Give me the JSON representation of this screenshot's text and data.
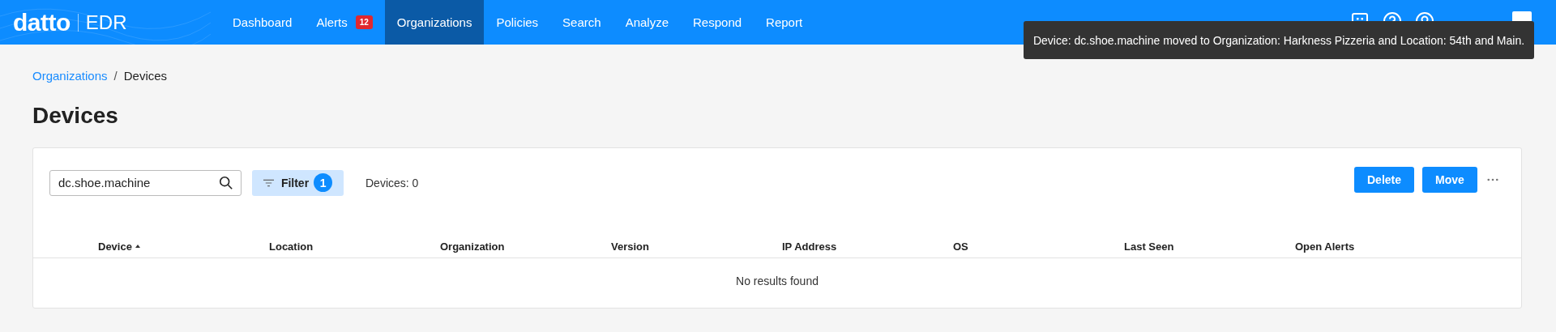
{
  "header": {
    "logo": "datto",
    "product": "EDR",
    "nav": [
      {
        "label": "Dashboard",
        "selected": false
      },
      {
        "label": "Alerts",
        "selected": false,
        "badge": "12"
      },
      {
        "label": "Organizations",
        "selected": true
      },
      {
        "label": "Policies",
        "selected": false
      },
      {
        "label": "Search",
        "selected": false
      },
      {
        "label": "Analyze",
        "selected": false
      },
      {
        "label": "Respond",
        "selected": false
      },
      {
        "label": "Report",
        "selected": false
      }
    ]
  },
  "toast": {
    "message": "Device: dc.shoe.machine moved to Organization: Harkness Pizzeria and Location: 54th and Main."
  },
  "breadcrumb": {
    "separator": "/",
    "items": [
      {
        "label": "Organizations",
        "link": true
      },
      {
        "label": "Devices",
        "link": false
      }
    ]
  },
  "page_title": "Devices",
  "toolbar": {
    "search": {
      "value": "dc.shoe.machine"
    },
    "filter": {
      "label": "Filter",
      "count": "1"
    },
    "device_count": "Devices: 0",
    "buttons": [
      "Delete",
      "Move"
    ]
  },
  "table": {
    "columns": [
      {
        "label": "Device",
        "sorted": true
      },
      {
        "label": "Location",
        "sorted": false
      },
      {
        "label": "Organization",
        "sorted": false
      },
      {
        "label": "Version",
        "sorted": false
      },
      {
        "label": "IP Address",
        "sorted": false
      },
      {
        "label": "OS",
        "sorted": false
      },
      {
        "label": "Last Seen",
        "sorted": false
      },
      {
        "label": "Open Alerts",
        "sorted": false
      }
    ],
    "empty_message": "No results found"
  }
}
